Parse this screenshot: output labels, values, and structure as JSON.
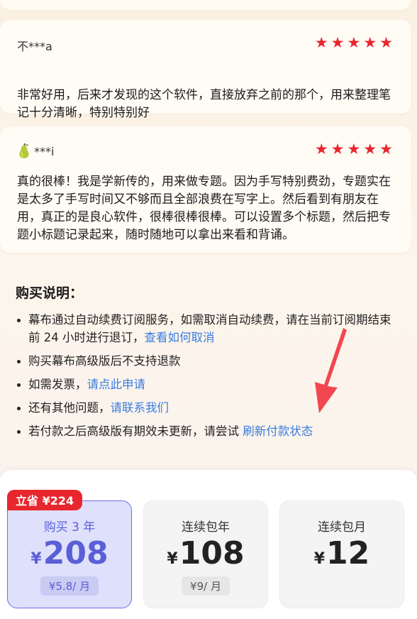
{
  "reviews": [
    {
      "user": "不***a",
      "stars": "★★★★★",
      "text": "非常好用，后来才发现的这个软件，直接放弃之前的那个，用来整理笔记十分清晰，特别特别好"
    },
    {
      "user": "***i",
      "avatar_icon": "pear-icon",
      "stars": "★★★★★",
      "text": "真的很棒！我是学新传的，用来做专题。因为手写特别费劲，专题实在是太多了手写时间又不够而且全部浪费在写字上。然后看到有朋友在用，真正的是良心软件，很棒很棒很棒。可以设置多个标题，然后把专题小标题记录起来，随时随地可以拿出来看和背诵。"
    }
  ],
  "purchase_notes": {
    "title": "购买说明：",
    "items": [
      {
        "text": "幕布通过自动续费订阅服务，如需取消自动续费，请在当前订阅期结束前 24 小时进行退订，",
        "link": "查看如何取消"
      },
      {
        "text": "购买幕布高级版后不支持退款",
        "link": ""
      },
      {
        "text": "如需发票，",
        "link": "请点此申请"
      },
      {
        "text": "还有其他问题，",
        "link": "请联系我们"
      },
      {
        "text": "若付款之后高级版有期效未更新，请尝试 ",
        "link": "刷新付款状态"
      }
    ]
  },
  "plans": {
    "save_badge": "立省 ¥224",
    "options": [
      {
        "name": "购买 3 年",
        "currency": "¥",
        "price": "208",
        "per": "¥5.8/ 月",
        "selected": true
      },
      {
        "name": "连续包年",
        "currency": "¥",
        "price": "108",
        "per": "¥9/ 月",
        "selected": false
      },
      {
        "name": "连续包月",
        "currency": "¥",
        "price": "12",
        "per": "",
        "selected": false
      }
    ]
  },
  "colors": {
    "accent": "#5a5fd6",
    "star": "#e8262e",
    "link": "#3a7be0",
    "annotation_arrow": "#f2474f"
  },
  "icons": [
    "star-icon",
    "pear-icon",
    "annotation-arrow-icon"
  ]
}
